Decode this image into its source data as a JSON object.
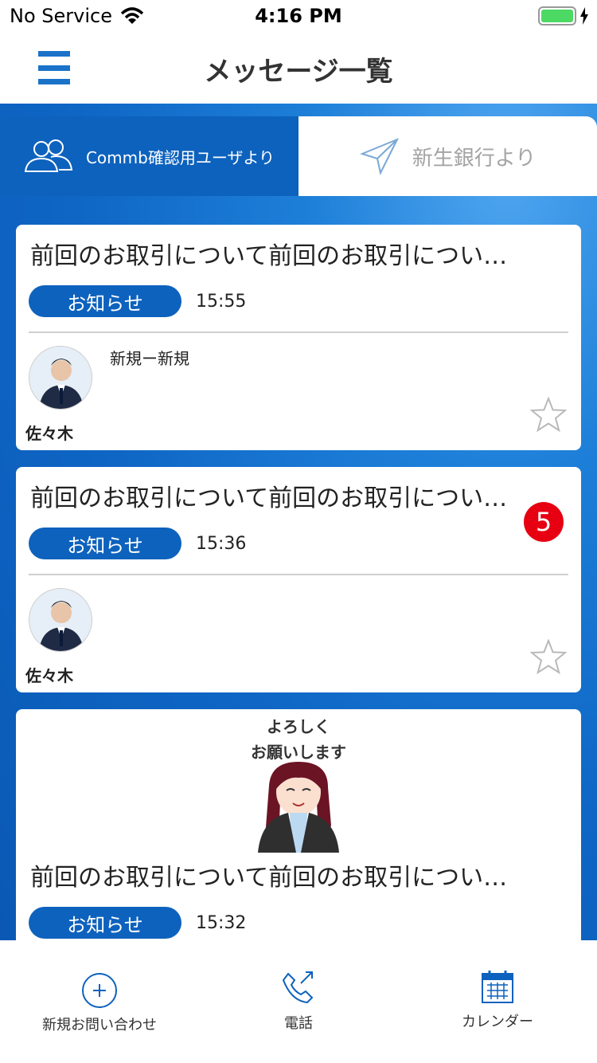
{
  "status_bar": {
    "carrier": "No Service",
    "time": "4:16 PM"
  },
  "header": {
    "title": "メッセージ一覧"
  },
  "tabs": [
    {
      "label": "Commb確認用ユーザより",
      "active": true
    },
    {
      "label": "新生銀行より",
      "active": false
    }
  ],
  "messages": [
    {
      "title": "前回のお取引について前回のお取引につい…",
      "category": "お知らせ",
      "time": "15:55",
      "sender": "佐々木",
      "preview": "新規ー新規"
    },
    {
      "title": "前回のお取引について前回のお取引につい…",
      "category": "お知らせ",
      "time": "15:36",
      "sender": "佐々木",
      "preview": "",
      "badge": "5"
    },
    {
      "title": "前回のお取引について前回のお取引につい…",
      "category": "お知らせ",
      "time": "15:32",
      "sticker_text_line1": "よろしく",
      "sticker_text_line2": "お願いします"
    }
  ],
  "bottom_nav": [
    {
      "label": "新規お問い合わせ",
      "icon": "plus-circle-icon"
    },
    {
      "label": "電話",
      "icon": "phone-icon"
    },
    {
      "label": "カレンダー",
      "icon": "calendar-icon"
    }
  ],
  "colors": {
    "brand_blue": "#0d62bd",
    "badge_red": "#e60012",
    "battery_green": "#4cd964"
  }
}
